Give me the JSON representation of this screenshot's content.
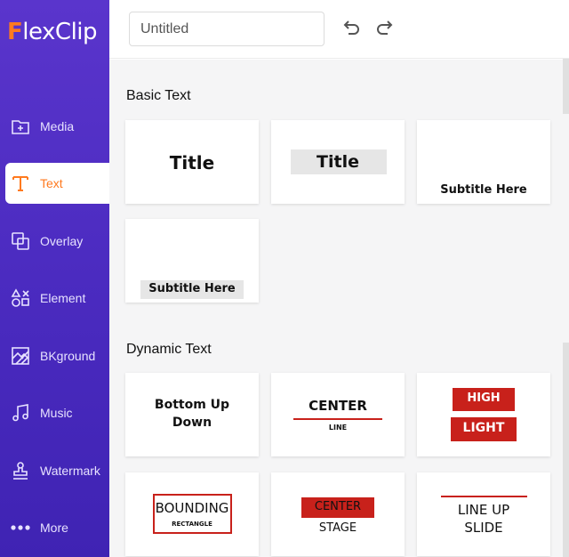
{
  "app": {
    "logo_first_letter": "F",
    "logo_rest": "lexClip"
  },
  "sidebar": {
    "items": [
      {
        "label": "Media",
        "icon": "media-folder-icon"
      },
      {
        "label": "Text",
        "icon": "text-t-icon",
        "active": true
      },
      {
        "label": "Overlay",
        "icon": "overlay-icon"
      },
      {
        "label": "Element",
        "icon": "element-shapes-icon"
      },
      {
        "label": "BKground",
        "icon": "background-icon"
      },
      {
        "label": "Music",
        "icon": "music-note-icon"
      },
      {
        "label": "Watermark",
        "icon": "watermark-stamp-icon"
      },
      {
        "label": "More",
        "icon": "more-dots-icon"
      }
    ]
  },
  "topbar": {
    "title_placeholder": "Untitled",
    "undo_icon": "undo-icon",
    "redo_icon": "redo-icon"
  },
  "sections": {
    "basic_title": "Basic Text",
    "dynamic_title": "Dynamic Text"
  },
  "basic_cards": {
    "title_plain": "Title",
    "title_boxed": "Title",
    "subtitle_plain": "Subtitle Here",
    "subtitle_boxed": "Subtitle Here"
  },
  "dynamic_cards": {
    "bottom_up_line1": "Bottom Up",
    "bottom_up_line2": "Down",
    "center_line_main": "CENTER",
    "center_line_sub": "LINE",
    "high_light_top": "HIGH",
    "high_light_bottom": "LIGHT",
    "bounding_main": "BOUNDING",
    "bounding_sub": "RECTANGLE",
    "center_stage_top": "CENTER",
    "center_stage_bottom": "STAGE",
    "line_up_line1": "LINE UP",
    "line_up_line2": "SLIDE"
  },
  "colors": {
    "sidebar": "#4b2bc0",
    "accent": "#ff7a1f",
    "red": "#c8211b",
    "grey_box": "#e6e6e6"
  }
}
